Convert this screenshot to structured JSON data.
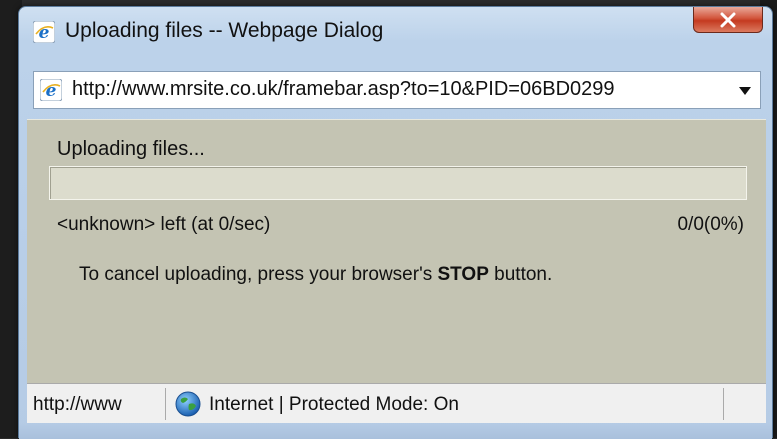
{
  "window": {
    "title": "Uploading files -- Webpage Dialog",
    "close_label": "X"
  },
  "address": {
    "url": "http://www.mrsite.co.uk/framebar.asp?to=10&PID=06BD0299"
  },
  "upload": {
    "heading": "Uploading files...",
    "progress_fraction": 0,
    "time_left": "<unknown> left (at 0/sec)",
    "count_percent": "0/0(0%)",
    "cancel_prefix": "To cancel uploading, press your browser's",
    "cancel_bold": "STOP",
    "cancel_suffix": "button."
  },
  "statusbar": {
    "url": "http://www",
    "zone": "Internet | Protected Mode: On"
  },
  "colors": {
    "dialog_bg": "#c4c4b3",
    "close_red": "#c43a20",
    "ie_blue": "#1a6fc7"
  },
  "icons": {
    "title": "ie-icon",
    "address": "ie-icon",
    "dropdown": "chevron-down-icon",
    "zone": "globe-icon",
    "close": "close-icon"
  }
}
